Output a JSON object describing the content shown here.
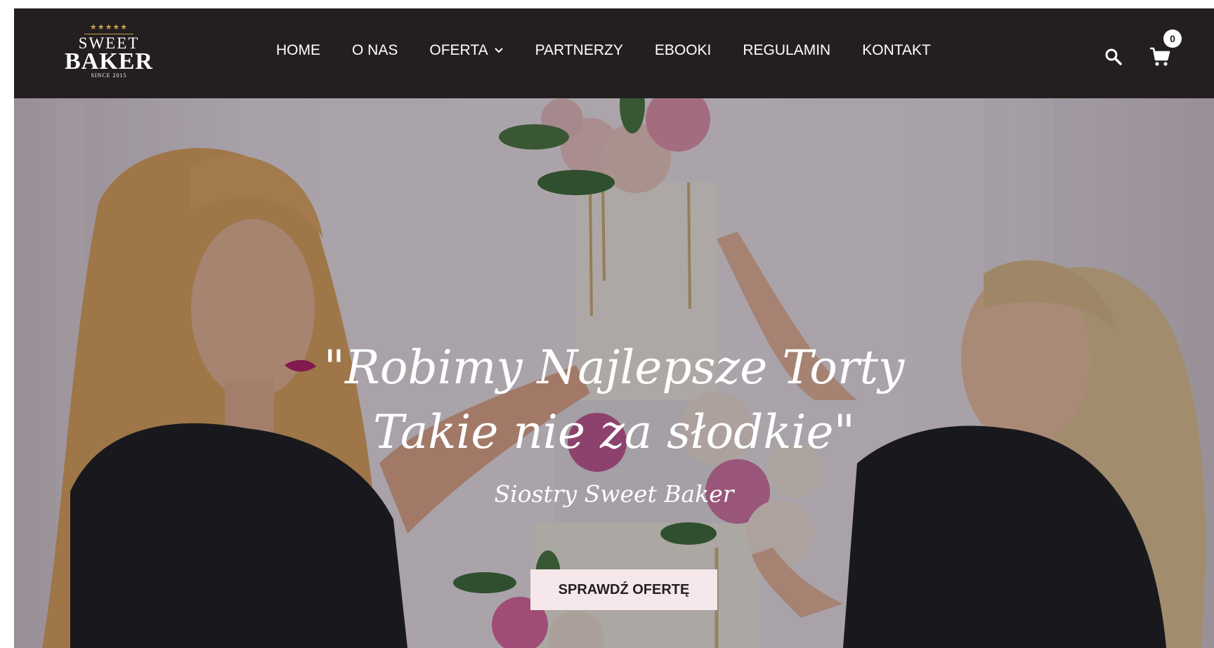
{
  "brand": {
    "stars": "★★★★★",
    "name_top": "SWEET",
    "name_bottom": "BAKER",
    "since": "SINCE 2015"
  },
  "nav": {
    "items": [
      "HOME",
      "O NAS",
      "OFERTA",
      "PARTNERZY",
      "EBOOKI",
      "REGULAMIN",
      "KONTAKT"
    ],
    "dropdown_item": "OFERTA"
  },
  "header_icons": {
    "search": "search-icon",
    "cart": "cart-icon",
    "cart_count": "0"
  },
  "hero": {
    "title_line1": "\"Robimy Najlepsze Torty",
    "title_line2": "Takie nie za słodkie\"",
    "subtitle": "Siostry Sweet Baker",
    "cta": "SPRAWDŹ OFERTĘ"
  },
  "colors": {
    "header_bg": "#231f20",
    "accent_gold": "#c9a24a",
    "cta_bg": "#f5e7ea",
    "text_light": "#ffffff"
  }
}
